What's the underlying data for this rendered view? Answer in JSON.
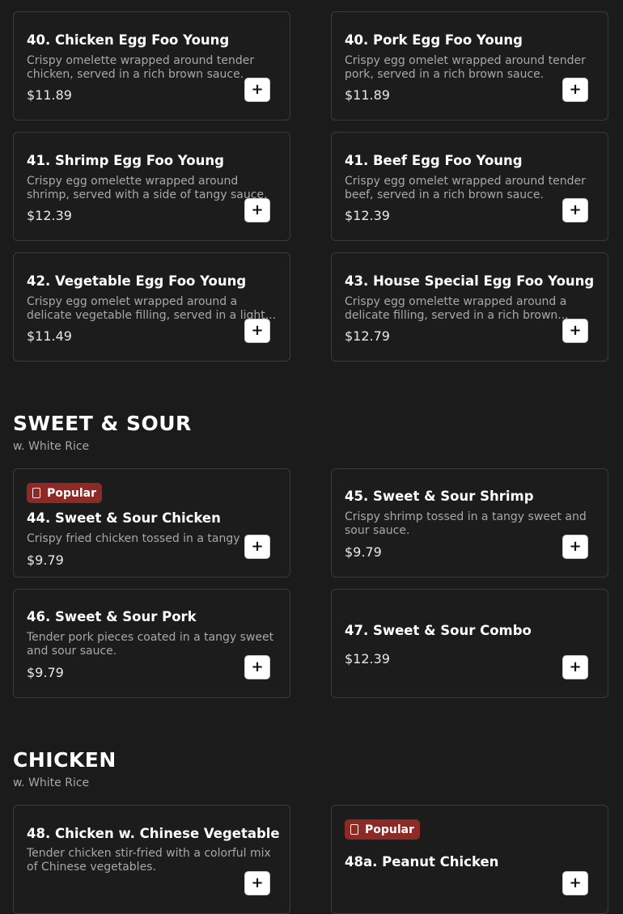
{
  "colors": {
    "background": "#1b1b1b",
    "card_border": "#3a3a3a",
    "popular_badge": "#8e2a26",
    "add_button": "#ffffff"
  },
  "add_button_icon": "plus-icon",
  "add_symbol": "+",
  "popular_icon": "flame-icon",
  "items": {
    "chicken_efy": {
      "name": "40. Chicken Egg Foo Young",
      "desc": "Crispy omelette wrapped around tender chicken, served in a rich brown sauce.",
      "price": "$11.89"
    },
    "pork_efy": {
      "name": "40. Pork Egg Foo Young",
      "desc": "Crispy egg omelet wrapped around tender pork, served in a rich brown sauce.",
      "price": "$11.89"
    },
    "shrimp_efy": {
      "name": "41. Shrimp Egg Foo Young",
      "desc": "Crispy egg omelette wrapped around shrimp, served with a side of tangy sauce.",
      "price": "$12.39"
    },
    "beef_efy": {
      "name": "41. Beef Egg Foo Young",
      "desc": "Crispy egg omelet wrapped around tender beef, served in a rich brown sauce.",
      "price": "$12.39"
    },
    "veg_efy": {
      "name": "42. Vegetable Egg Foo Young",
      "desc": "Crispy egg omelet wrapped around a delicate vegetable filling, served in a light...",
      "price": "$11.49"
    },
    "house_efy": {
      "name": "43. House Special Egg Foo Young",
      "desc": "Crispy egg omelette wrapped around a delicate filling, served in a rich brown...",
      "price": "$12.79"
    },
    "ss_chicken": {
      "badge": "Popular",
      "name": "44. Sweet & Sour Chicken",
      "desc": "Crispy fried chicken tossed in a tangy ...",
      "price": "$9.79"
    },
    "ss_shrimp": {
      "name": "45. Sweet & Sour Shrimp",
      "desc": "Crispy shrimp tossed in a tangy sweet and sour sauce.",
      "price": "$9.79"
    },
    "ss_pork": {
      "name": "46. Sweet & Sour Pork",
      "desc": "Tender pork pieces coated in a tangy sweet and sour sauce.",
      "price": "$9.79"
    },
    "ss_combo": {
      "name": "47. Sweet & Sour Combo",
      "price": "$12.39"
    },
    "chicken_veg": {
      "name": "48. Chicken w. Chinese Vegetable",
      "desc": "Tender chicken stir-fried with a colorful mix of Chinese vegetables."
    },
    "peanut_chicken": {
      "badge": "Popular",
      "name": "48a. Peanut Chicken"
    }
  },
  "sections": {
    "sweet_sour": {
      "title": "SWEET & SOUR",
      "subtitle": "w. White Rice"
    },
    "chicken": {
      "title": "CHICKEN",
      "subtitle": "w. White Rice"
    }
  }
}
